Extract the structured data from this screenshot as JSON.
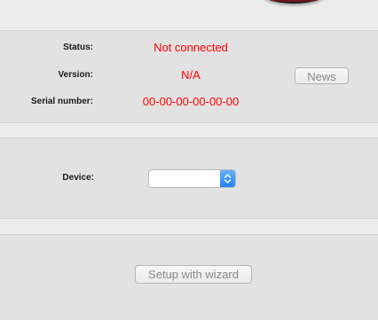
{
  "header": {
    "device_image_icon": "device-knob-image"
  },
  "info": {
    "status_label": "Status:",
    "status_value": "Not connected",
    "version_label": "Version:",
    "version_value": "N/A",
    "serial_label": "Serial number:",
    "serial_value": "00-00-00-00-00-00",
    "value_color": "#ff0000",
    "news_button_label": "News"
  },
  "device": {
    "label": "Device:",
    "selected_value": ""
  },
  "wizard": {
    "button_label": "Setup with wizard"
  }
}
